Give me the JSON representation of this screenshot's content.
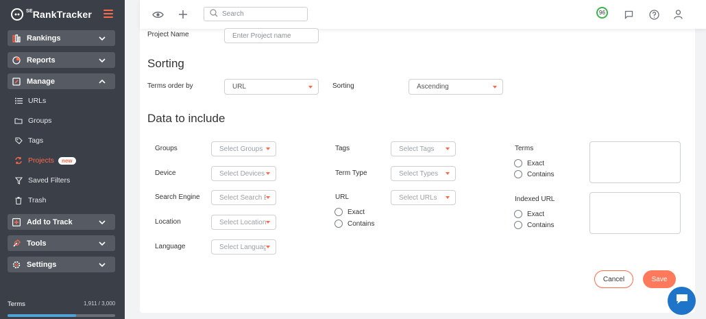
{
  "app": {
    "logo_text": "RankTracker",
    "logo_sup": "SE"
  },
  "sidebar": {
    "groups": [
      {
        "label": "Rankings"
      },
      {
        "label": "Reports"
      },
      {
        "label": "Manage"
      },
      {
        "label": "Add to Track"
      },
      {
        "label": "Tools"
      },
      {
        "label": "Settings"
      }
    ],
    "manage_items": [
      {
        "label": "URLs"
      },
      {
        "label": "Groups"
      },
      {
        "label": "Tags"
      },
      {
        "label": "Projects",
        "badge": "new"
      },
      {
        "label": "Saved Filters"
      },
      {
        "label": "Trash"
      }
    ],
    "terms": {
      "label": "Terms",
      "count": "1,911 / 3,000",
      "fraction": 0.637
    }
  },
  "topbar": {
    "search_placeholder": "Search",
    "score": "96"
  },
  "form": {
    "project_name_label": "Project Name",
    "project_name_placeholder": "Enter Project name",
    "sorting_heading": "Sorting",
    "terms_order_label": "Terms order by",
    "terms_order_value": "URL",
    "sorting_label": "Sorting",
    "sorting_value": "Ascending",
    "data_heading": "Data to include",
    "groups_label": "Groups",
    "groups_placeholder": "Select Groups",
    "device_label": "Device",
    "device_placeholder": "Select Devices",
    "engine_label": "Search Engine",
    "engine_placeholder": "Select Search E",
    "location_label": "Location",
    "location_placeholder": "Select Location",
    "language_label": "Language",
    "language_placeholder": "Select Languag",
    "tags_label": "Tags",
    "tags_placeholder": "Select Tags",
    "termtype_label": "Term Type",
    "termtype_placeholder": "Select Types",
    "url_label": "URL",
    "url_placeholder": "Select URLs",
    "terms_label": "Terms",
    "indexed_url_label": "Indexed URL",
    "exact": "Exact",
    "contains": "Contains",
    "cancel": "Cancel",
    "save": "Save"
  },
  "colors": {
    "accent": "#ff6a4d",
    "sidebar_bg": "#3a3f48",
    "chat": "#1d74c9"
  }
}
